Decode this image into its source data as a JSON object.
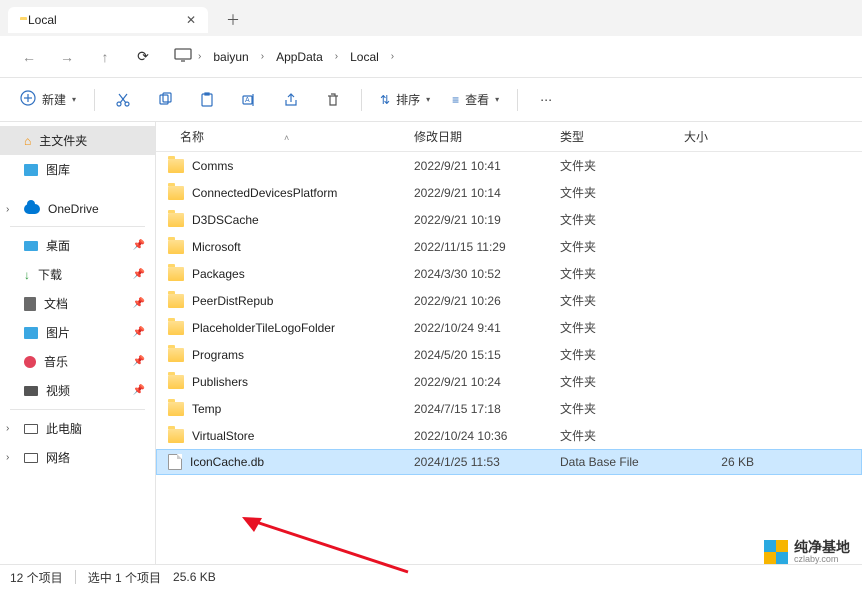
{
  "tab": {
    "title": "Local"
  },
  "breadcrumb": {
    "segments": [
      "baiyun",
      "AppData",
      "Local"
    ]
  },
  "toolbar": {
    "new": "新建",
    "sort": "排序",
    "view": "查看"
  },
  "sidebar": {
    "home": "主文件夹",
    "gallery": "图库",
    "onedrive": "OneDrive",
    "desktop": "桌面",
    "downloads": "下载",
    "documents": "文档",
    "pictures": "图片",
    "music": "音乐",
    "videos": "视频",
    "thispc": "此电脑",
    "network": "网络"
  },
  "columns": {
    "name": "名称",
    "date": "修改日期",
    "type": "类型",
    "size": "大小"
  },
  "files": [
    {
      "name": "Comms",
      "date": "2022/9/21 10:41",
      "type": "文件夹",
      "size": "",
      "icon": "folder"
    },
    {
      "name": "ConnectedDevicesPlatform",
      "date": "2022/9/21 10:14",
      "type": "文件夹",
      "size": "",
      "icon": "folder"
    },
    {
      "name": "D3DSCache",
      "date": "2022/9/21 10:19",
      "type": "文件夹",
      "size": "",
      "icon": "folder"
    },
    {
      "name": "Microsoft",
      "date": "2022/11/15 11:29",
      "type": "文件夹",
      "size": "",
      "icon": "folder"
    },
    {
      "name": "Packages",
      "date": "2024/3/30 10:52",
      "type": "文件夹",
      "size": "",
      "icon": "folder"
    },
    {
      "name": "PeerDistRepub",
      "date": "2022/9/21 10:26",
      "type": "文件夹",
      "size": "",
      "icon": "folder"
    },
    {
      "name": "PlaceholderTileLogoFolder",
      "date": "2022/10/24 9:41",
      "type": "文件夹",
      "size": "",
      "icon": "folder"
    },
    {
      "name": "Programs",
      "date": "2024/5/20 15:15",
      "type": "文件夹",
      "size": "",
      "icon": "folder"
    },
    {
      "name": "Publishers",
      "date": "2022/9/21 10:24",
      "type": "文件夹",
      "size": "",
      "icon": "folder"
    },
    {
      "name": "Temp",
      "date": "2024/7/15 17:18",
      "type": "文件夹",
      "size": "",
      "icon": "folder"
    },
    {
      "name": "VirtualStore",
      "date": "2022/10/24 10:36",
      "type": "文件夹",
      "size": "",
      "icon": "folder"
    },
    {
      "name": "IconCache.db",
      "date": "2024/1/25 11:53",
      "type": "Data Base File",
      "size": "26 KB",
      "icon": "file",
      "selected": true
    }
  ],
  "status": {
    "count": "12 个项目",
    "selected": "选中 1 个项目",
    "size": "25.6 KB"
  },
  "watermark": {
    "cn": "纯净基地",
    "en": "czlaby.com"
  }
}
